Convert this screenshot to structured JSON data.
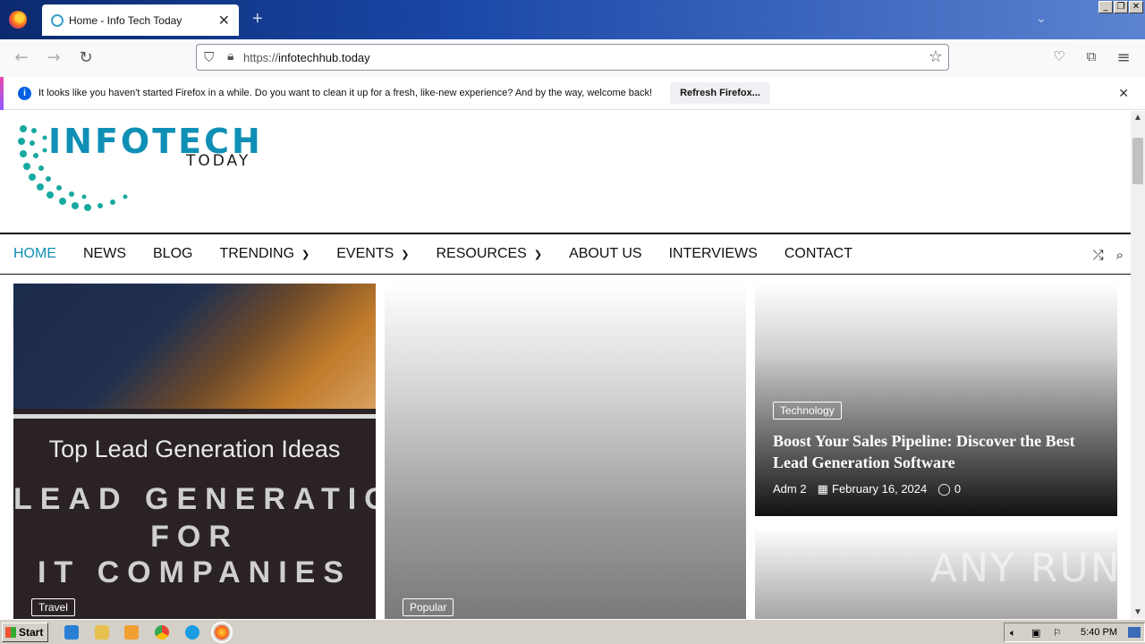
{
  "browser": {
    "tab_title": "Home - Info Tech Today",
    "url_prefix": "https://",
    "url_host": "infotechhub.today"
  },
  "notification": {
    "message": "It looks like you haven't started Firefox in a while. Do you want to clean it up for a fresh, like-new experience? And by the way, welcome back!",
    "button": "Refresh Firefox..."
  },
  "site": {
    "logo_name": "INFOTECH",
    "logo_sub": "TODAY",
    "menu": [
      {
        "label": "HOME"
      },
      {
        "label": "NEWS"
      },
      {
        "label": "BLOG"
      },
      {
        "label": "TRENDING"
      },
      {
        "label": "EVENTS"
      },
      {
        "label": "RESOURCES"
      },
      {
        "label": "ABOUT US"
      },
      {
        "label": "INTERVIEWS"
      },
      {
        "label": "CONTACT"
      }
    ]
  },
  "cards": {
    "card1": {
      "image_heading": "Top Lead Generation Ideas",
      "image_line1": "LEAD GENERATION",
      "image_line2": "FOR",
      "image_line3": "IT COMPANIES",
      "tag": "Travel"
    },
    "card2": {
      "tag": "Popular"
    },
    "card3": {
      "tag": "Technology",
      "title": "Boost Your Sales Pipeline: Discover the Best Lead Generation Software",
      "author": "Adm 2",
      "date": "February 16, 2024",
      "comments": "0"
    }
  },
  "watermark": "ANY RUN",
  "taskbar": {
    "start": "Start",
    "clock": "5:40 PM"
  }
}
